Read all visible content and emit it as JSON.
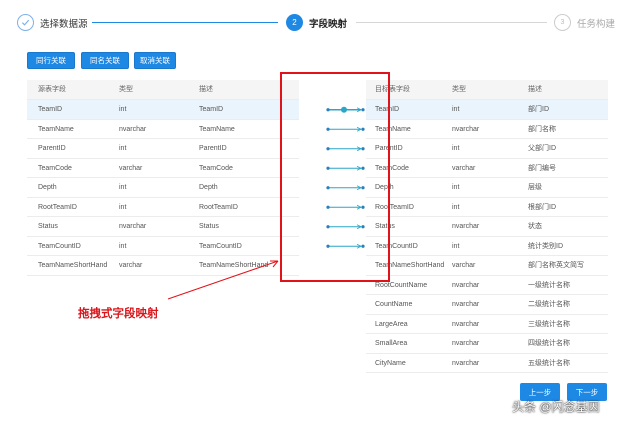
{
  "steps": [
    {
      "number": "",
      "label": "选择数据源"
    },
    {
      "number": "2",
      "label": "字段映射"
    },
    {
      "number": "3",
      "label": "任务构建"
    }
  ],
  "toolbar": {
    "row_assoc": "同行关联",
    "name_assoc": "同名关联",
    "cancel_assoc": "取消关联"
  },
  "source_table": {
    "headers": [
      "源表字段",
      "类型",
      "描述"
    ],
    "rows": [
      [
        "TeamID",
        "int",
        "TeamID"
      ],
      [
        "TeamName",
        "nvarchar",
        "TeamName"
      ],
      [
        "ParentID",
        "int",
        "ParentID"
      ],
      [
        "TeamCode",
        "varchar",
        "TeamCode"
      ],
      [
        "Depth",
        "int",
        "Depth"
      ],
      [
        "RootTeamID",
        "int",
        "RootTeamID"
      ],
      [
        "Status",
        "nvarchar",
        "Status"
      ],
      [
        "TeamCountID",
        "int",
        "TeamCountID"
      ],
      [
        "TeamNameShortHand",
        "varchar",
        "TeamNameShortHand"
      ]
    ]
  },
  "target_table": {
    "headers": [
      "目标表字段",
      "类型",
      "描述"
    ],
    "rows": [
      [
        "TeamID",
        "int",
        "部门ID"
      ],
      [
        "TeamName",
        "nvarchar",
        "部门名称"
      ],
      [
        "ParentID",
        "int",
        "父部门ID"
      ],
      [
        "TeamCode",
        "varchar",
        "部门编号"
      ],
      [
        "Depth",
        "int",
        "层级"
      ],
      [
        "RootTeamID",
        "int",
        "根部门ID"
      ],
      [
        "Status",
        "nvarchar",
        "状态"
      ],
      [
        "TeamCountID",
        "int",
        "统计类别ID"
      ],
      [
        "TeamNameShortHand",
        "varchar",
        "部门名称英文简写"
      ],
      [
        "RootCountName",
        "nvarchar",
        "一级统计名称"
      ],
      [
        "CountName",
        "nvarchar",
        "二级统计名称"
      ],
      [
        "LargeArea",
        "nvarchar",
        "三级统计名称"
      ],
      [
        "SmallArea",
        "nvarchar",
        "四级统计名称"
      ],
      [
        "CityName",
        "nvarchar",
        "五级统计名称"
      ]
    ]
  },
  "mapping_count": 9,
  "annotation": "拖拽式字段映射",
  "footer": {
    "prev": "上一步",
    "next": "下一步"
  },
  "watermark": "头条 @闪念基因",
  "colors": {
    "accent": "#1e88e5",
    "annotation": "#e0131a",
    "mapping_line": "#2aa6c8"
  }
}
